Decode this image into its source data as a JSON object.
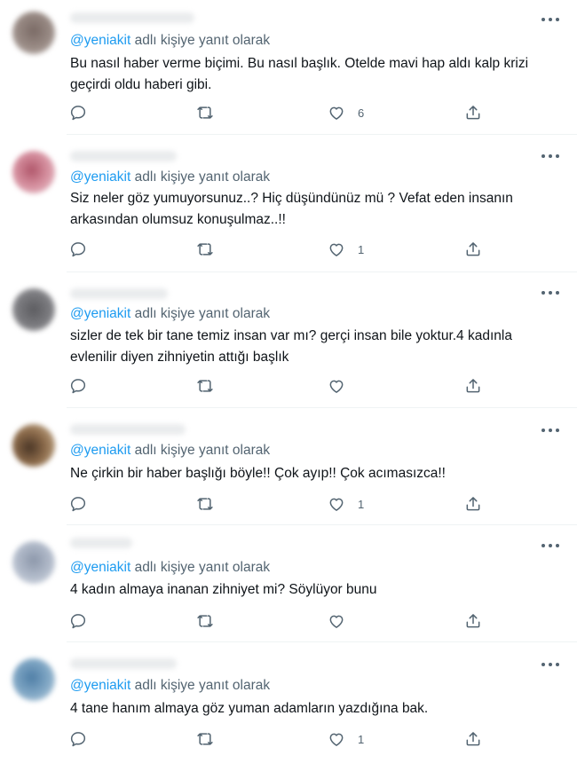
{
  "reply_prefix_suffix": "adlı kişiye yanıt olarak",
  "tweets": [
    {
      "handle": "@yeniakit",
      "text": "Bu nasıl haber verme biçimi. Bu nasıl başlık. Otelde mavi hap aldı kalp krizi geçirdi oldu haberi gibi.",
      "like_count": "6",
      "avatar_color": "#8d7d77"
    },
    {
      "handle": "@yeniakit",
      "text": "Siz neler göz yumuyorsunuz..? Hiç düşündünüz mü ? Vefat eden insanın arkasından olumsuz konuşulmaz..!!",
      "like_count": "1",
      "avatar_color": "#c77f8e"
    },
    {
      "handle": "@yeniakit",
      "text": "sizler de tek bir tane temiz insan var mı? gerçi insan bile yoktur.4 kadınla evlenilir diyen zihniyetin attığı başlık",
      "like_count": "",
      "avatar_color": "#6e6e72"
    },
    {
      "handle": "@yeniakit",
      "text": "Ne çirkin bir haber başlığı böyle!! Çok ayıp!! Çok acımasızca!!",
      "like_count": "1",
      "avatar_color": "#7a5a44"
    },
    {
      "handle": "@yeniakit",
      "text": "4 kadın almaya inanan zihniyet mi? Söylüyor bunu",
      "like_count": "",
      "avatar_color": "#a9b3c4"
    },
    {
      "handle": "@yeniakit",
      "text": "4 tane hanım almaya göz yuman adamların yazdığına bak.",
      "like_count": "1",
      "avatar_color": "#6f97b8"
    }
  ],
  "colors": {
    "link": "#1d9bf0",
    "secondary_text": "#536471",
    "primary_text": "#0f1419",
    "divider": "#eff3f4"
  },
  "icons": {
    "reply": "reply-icon",
    "retweet": "retweet-icon",
    "like": "like-icon",
    "share": "share-icon",
    "more": "more-icon"
  }
}
